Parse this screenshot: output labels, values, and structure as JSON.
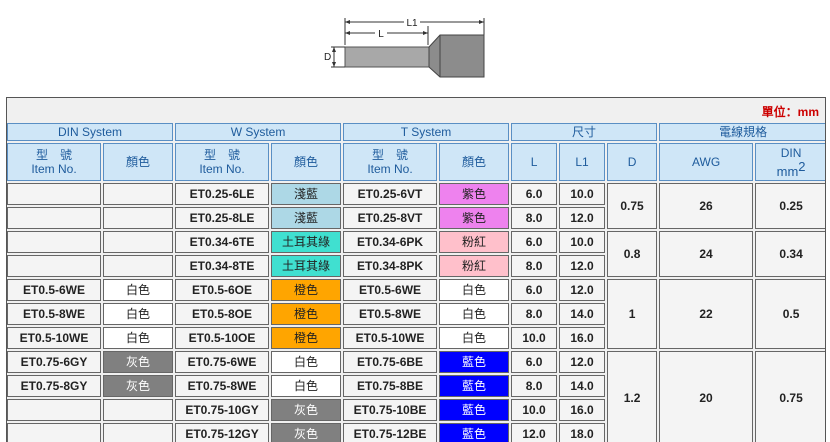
{
  "diagram": {
    "label_l1": "L1",
    "label_l": "L",
    "label_d": "D"
  },
  "unit_label": "單位：mm",
  "group_headers": {
    "din_system": "DIN System",
    "w_system": "W System",
    "t_system": "T System",
    "size": "尺寸",
    "wire_spec": "電線規格"
  },
  "sub_headers": {
    "item_cn": "型　號",
    "item_en": "Item No.",
    "color": "顏色",
    "l": "L",
    "l1": "L1",
    "d": "D",
    "awg": "AWG",
    "din": "DIN",
    "din_unit": "mm"
  },
  "colors": {
    "light_blue": "#add8e6",
    "turquoise": "#40e0d0",
    "orange": "#ffa500",
    "white": "#ffffff",
    "gray": "#808080",
    "violet": "#ee82ee",
    "pink": "#ffc0cb",
    "blue": "#0000ff"
  },
  "rows": [
    {
      "din_item": "",
      "din_color": "",
      "din_swatch": "",
      "w_item": "ET0.25-6LE",
      "w_color": "淺藍",
      "w_swatch": "light_blue",
      "t_item": "ET0.25-6VT",
      "t_color": "紫色",
      "t_swatch": "violet",
      "l": "6.0",
      "l1": "10.0"
    },
    {
      "din_item": "",
      "din_color": "",
      "din_swatch": "",
      "w_item": "ET0.25-8LE",
      "w_color": "淺藍",
      "w_swatch": "light_blue",
      "t_item": "ET0.25-8VT",
      "t_color": "紫色",
      "t_swatch": "violet",
      "l": "8.0",
      "l1": "12.0"
    },
    {
      "din_item": "",
      "din_color": "",
      "din_swatch": "",
      "w_item": "ET0.34-6TE",
      "w_color": "土耳其綠",
      "w_swatch": "turquoise",
      "t_item": "ET0.34-6PK",
      "t_color": "粉紅",
      "t_swatch": "pink",
      "l": "6.0",
      "l1": "10.0"
    },
    {
      "din_item": "",
      "din_color": "",
      "din_swatch": "",
      "w_item": "ET0.34-8TE",
      "w_color": "土耳其綠",
      "w_swatch": "turquoise",
      "t_item": "ET0.34-8PK",
      "t_color": "粉紅",
      "t_swatch": "pink",
      "l": "8.0",
      "l1": "12.0"
    },
    {
      "din_item": "ET0.5-6WE",
      "din_color": "白色",
      "din_swatch": "white",
      "w_item": "ET0.5-6OE",
      "w_color": "橙色",
      "w_swatch": "orange",
      "t_item": "ET0.5-6WE",
      "t_color": "白色",
      "t_swatch": "white",
      "l": "6.0",
      "l1": "12.0"
    },
    {
      "din_item": "ET0.5-8WE",
      "din_color": "白色",
      "din_swatch": "white",
      "w_item": "ET0.5-8OE",
      "w_color": "橙色",
      "w_swatch": "orange",
      "t_item": "ET0.5-8WE",
      "t_color": "白色",
      "t_swatch": "white",
      "l": "8.0",
      "l1": "14.0"
    },
    {
      "din_item": "ET0.5-10WE",
      "din_color": "白色",
      "din_swatch": "white",
      "w_item": "ET0.5-10OE",
      "w_color": "橙色",
      "w_swatch": "orange",
      "t_item": "ET0.5-10WE",
      "t_color": "白色",
      "t_swatch": "white",
      "l": "10.0",
      "l1": "16.0"
    },
    {
      "din_item": "ET0.75-6GY",
      "din_color": "灰色",
      "din_swatch": "gray",
      "w_item": "ET0.75-6WE",
      "w_color": "白色",
      "w_swatch": "white",
      "t_item": "ET0.75-6BE",
      "t_color": "藍色",
      "t_swatch": "blue",
      "l": "6.0",
      "l1": "12.0"
    },
    {
      "din_item": "ET0.75-8GY",
      "din_color": "灰色",
      "din_swatch": "gray",
      "w_item": "ET0.75-8WE",
      "w_color": "白色",
      "w_swatch": "white",
      "t_item": "ET0.75-8BE",
      "t_color": "藍色",
      "t_swatch": "blue",
      "l": "8.0",
      "l1": "14.0"
    },
    {
      "din_item": "",
      "din_color": "",
      "din_swatch": "",
      "w_item": "ET0.75-10GY",
      "w_color": "灰色",
      "w_swatch": "gray",
      "t_item": "ET0.75-10BE",
      "t_color": "藍色",
      "t_swatch": "blue",
      "l": "10.0",
      "l1": "16.0"
    },
    {
      "din_item": "",
      "din_color": "",
      "din_swatch": "",
      "w_item": "ET0.75-12GY",
      "w_color": "灰色",
      "w_swatch": "gray",
      "t_item": "ET0.75-12BE",
      "t_color": "藍色",
      "t_swatch": "blue",
      "l": "12.0",
      "l1": "18.0"
    }
  ],
  "wire_groups": [
    {
      "d": "0.75",
      "awg": "26",
      "din_mm2": "0.25"
    },
    {
      "d": "0.8",
      "awg": "24",
      "din_mm2": "0.34"
    },
    {
      "d": "1",
      "awg": "22",
      "din_mm2": "0.5"
    },
    {
      "d": "1.2",
      "awg": "20",
      "din_mm2": "0.75"
    }
  ]
}
